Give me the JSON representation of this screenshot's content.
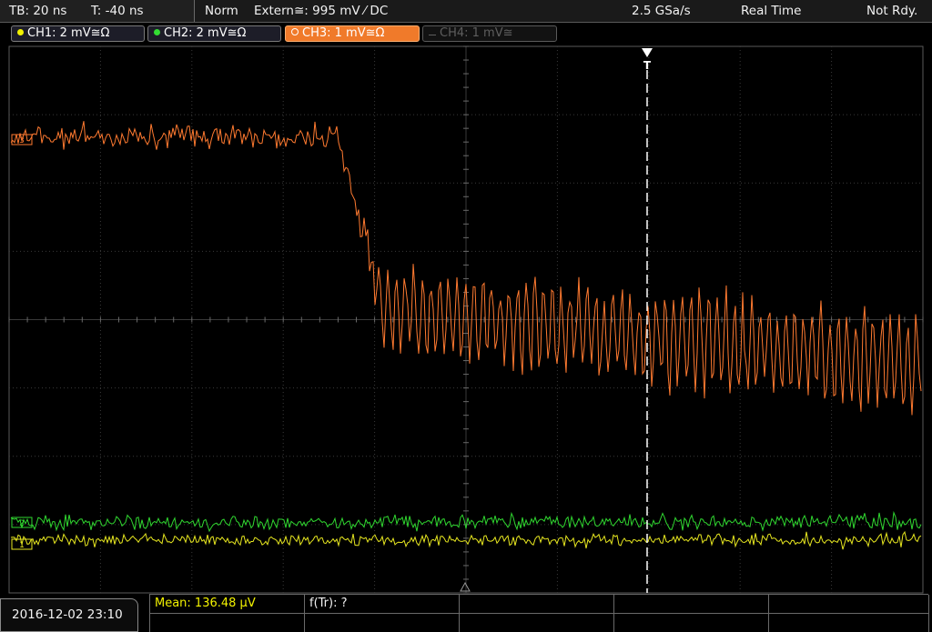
{
  "status_bar": {
    "timebase": "TB: 20 ns",
    "trigger_time": "T: -40 ns",
    "trigger_mode": "Norm",
    "trigger_source": "Extern≅: 995 mV ⁄ DC",
    "sample_rate": "2.5 GSa/s",
    "acquisition_mode": "Real Time",
    "status": "Not Rdy."
  },
  "channels": [
    {
      "label": "CH1: 2 mV≅Ω",
      "color": "#f2f200",
      "state": "on"
    },
    {
      "label": "CH2: 2 mV≅Ω",
      "color": "#33dd33",
      "state": "on"
    },
    {
      "label": "CH3: 1 mV≅Ω",
      "color": "#ff8030",
      "state": "active"
    },
    {
      "label": "CH4: 1 mV≅",
      "color": "#5e5e5e",
      "state": "off"
    }
  ],
  "trigger_marker": {
    "label": "T"
  },
  "channel_markers": {
    "ch3": "3",
    "ch1": "1",
    "ch2": "2"
  },
  "measurements": {
    "mean_label": "Mean: 136.48 µV",
    "rise_time_label": "f(Tr): ?"
  },
  "datetime": "2016-12-02 23:10",
  "colors": {
    "grid": "#3a3a3a",
    "grid_axis": "#6a6a6a",
    "ch1": "#e8e820",
    "ch2": "#30d830",
    "ch3": "#ff7a30",
    "trigger_line": "#ffffff"
  }
}
